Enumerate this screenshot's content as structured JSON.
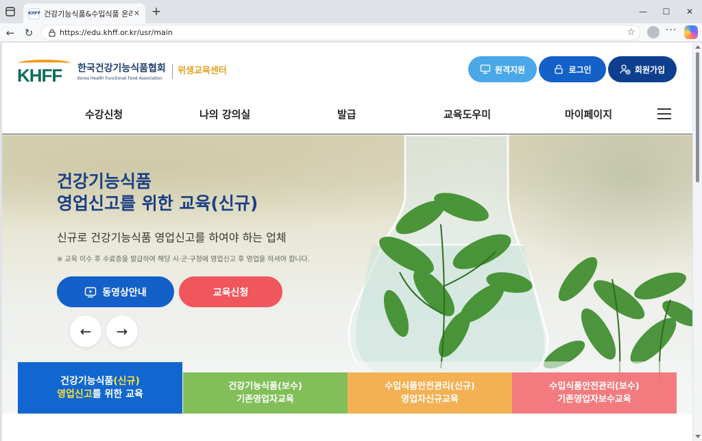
{
  "browser": {
    "tab_title": "건강기능식품&수입식품 온라인 교육",
    "tab_favicon_text": "KHFF",
    "url": "https://edu.khff.or.kr/usr/main",
    "close_symbol": "✕",
    "new_tab_symbol": "+",
    "minimize_symbol": "—",
    "maximize_symbol": "☐",
    "window_close_symbol": "✕",
    "back_symbol": "←",
    "reload_symbol": "↻",
    "star_symbol": "☆",
    "more_symbol": "···"
  },
  "header": {
    "logo_khff": "KHFF",
    "logo_korean": "한국건강기능식품협회",
    "logo_english": "Korea Health Functional Food Association",
    "logo_center": "위생교육센터",
    "remote_support": "원격지원",
    "login": "로그인",
    "join": "회원가입"
  },
  "nav": {
    "items": [
      "수강신청",
      "나의 강의실",
      "발급",
      "교육도우미",
      "마이페이지"
    ]
  },
  "hero": {
    "title_line1": "건강기능식품",
    "title_line2": "영업신고를 위한 교육(신규)",
    "subtitle": "신규로 건강기능식품 영업신고를 하여야 하는 업체",
    "note": "※ 교육 이수 후 수료증을 발급하여 해당 시·군·구청에 영업신고 후 영업을 하셔야 합니다.",
    "video_button": "동영상안내",
    "apply_button": "교육신청",
    "prev_arrow": "←",
    "next_arrow": "→"
  },
  "course_tabs": [
    {
      "line1_a": "건강기능식품",
      "line1_b": "(신규)",
      "line2_a": "영업신고",
      "line2_b": "를 위한 교육"
    },
    {
      "line1": "건강기능식품(보수)",
      "line2": "기존영업자교육"
    },
    {
      "line1": "수입식품안전관리(신규)",
      "line2": "영업자신규교육"
    },
    {
      "line1": "수입식품안전관리(보수)",
      "line2": "기존영업자보수교육"
    }
  ]
}
